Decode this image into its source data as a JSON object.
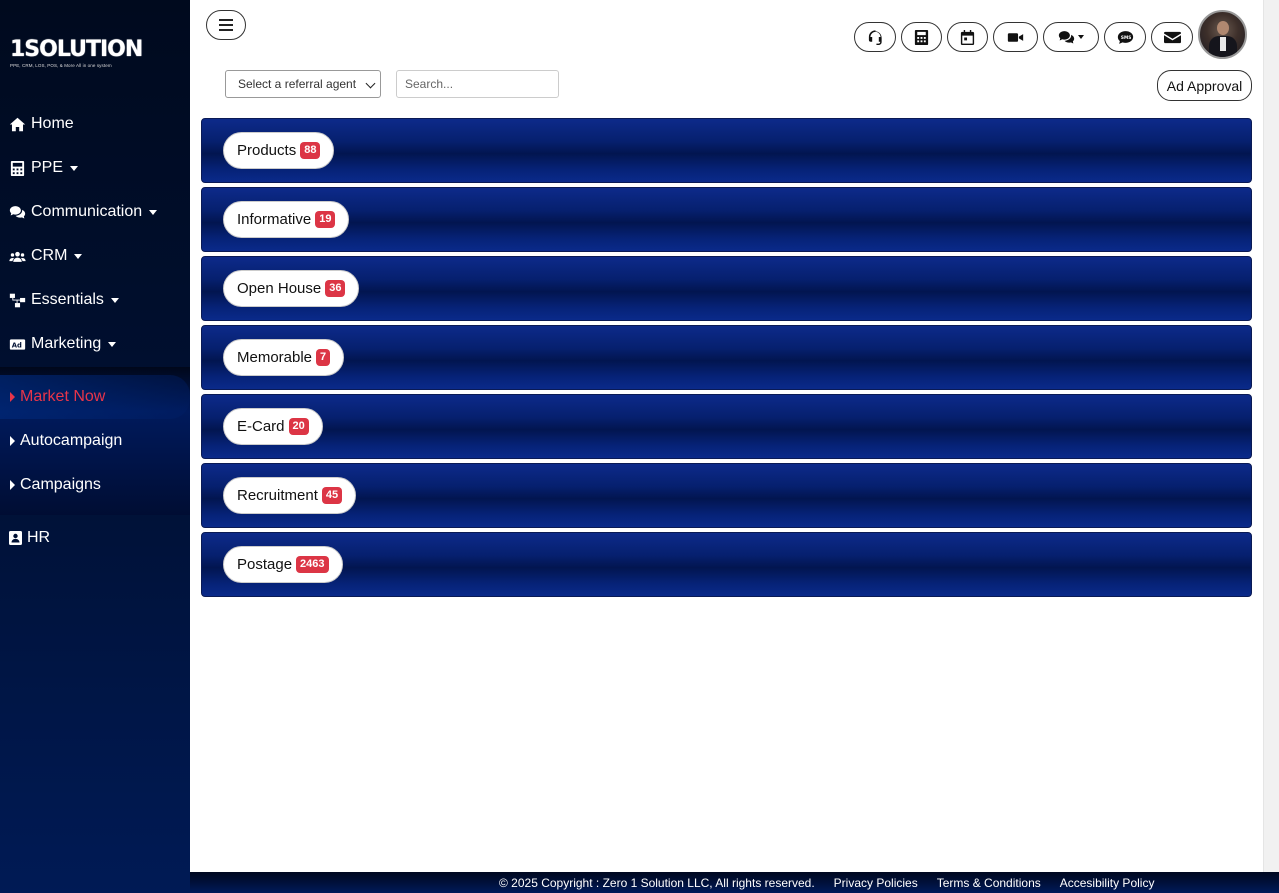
{
  "logo": {
    "text": "1SOLUTION",
    "tagline": "PPE, CRM, LOS, POS, & More All in one system"
  },
  "sidebar": {
    "items": [
      {
        "label": "Home",
        "icon": "home-icon",
        "dropdown": false
      },
      {
        "label": "PPE",
        "icon": "calculator-icon",
        "dropdown": true
      },
      {
        "label": "Communication",
        "icon": "comments-icon",
        "dropdown": true
      },
      {
        "label": "CRM",
        "icon": "users-icon",
        "dropdown": true
      },
      {
        "label": "Essentials",
        "icon": "sitemap-icon",
        "dropdown": true
      },
      {
        "label": "Marketing",
        "icon": "ad-icon",
        "dropdown": true
      }
    ],
    "marketing_sub": [
      {
        "label": "Market Now",
        "active": true
      },
      {
        "label": "Autocampaign",
        "active": false
      },
      {
        "label": "Campaigns",
        "active": false
      }
    ],
    "hr": {
      "label": "HR",
      "icon": "id-badge-icon"
    }
  },
  "topbar": {
    "icons": [
      "headset-icon",
      "calculator-icon",
      "calendar-icon",
      "video-icon",
      "chat-dropdown-icon",
      "sms-icon",
      "envelope-icon"
    ],
    "sms_label": "SMS"
  },
  "filters": {
    "agent_select": "Select a referral agent",
    "search_placeholder": "Search...",
    "ad_approval": "Ad Approval"
  },
  "categories": [
    {
      "label": "Products",
      "count": "88"
    },
    {
      "label": "Informative",
      "count": "19"
    },
    {
      "label": "Open House",
      "count": "36"
    },
    {
      "label": "Memorable",
      "count": "7"
    },
    {
      "label": "E-Card",
      "count": "20"
    },
    {
      "label": "Recruitment",
      "count": "45"
    },
    {
      "label": "Postage",
      "count": "2463"
    }
  ],
  "footer": {
    "copyright": "© 2025 Copyright : Zero 1 Solution LLC, All rights reserved.",
    "links": [
      "Privacy Policies",
      "Terms & Conditions",
      "Accesibility Policy"
    ]
  },
  "colors": {
    "sidebar_bg": "#001033",
    "bar_blue": "#06206f",
    "badge_red": "#dc3545",
    "active_red": "#e8354a"
  }
}
